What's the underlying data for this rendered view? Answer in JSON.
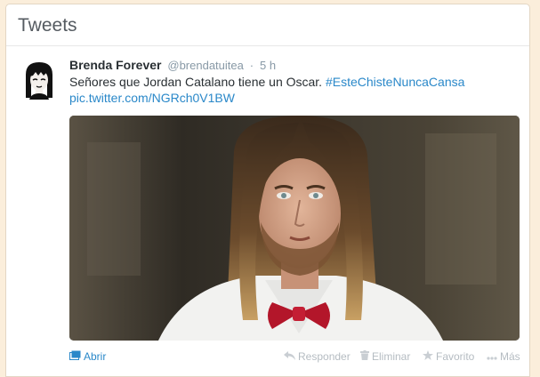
{
  "header": {
    "title": "Tweets"
  },
  "tweet": {
    "fullname": "Brenda Forever",
    "username": "@brendatuitea",
    "separator": "·",
    "time": "5 h",
    "text": "Señores que Jordan Catalano tiene un Oscar.",
    "hashtag": "#EsteChisteNuncaCansa",
    "media_link": "pic.twitter.com/NGRch0V1BW"
  },
  "actions": {
    "open": "Abrir",
    "reply": "Responder",
    "delete": "Eliminar",
    "favorite": "Favorito",
    "more": "Más"
  },
  "icons": {
    "open": "media-open-icon",
    "reply": "reply-icon",
    "delete": "trash-icon",
    "favorite": "star-icon",
    "more": "more-dots-icon"
  },
  "colors": {
    "link": "#2a88c9",
    "page_bg": "#fbeedb",
    "muted": "#8899a6"
  }
}
